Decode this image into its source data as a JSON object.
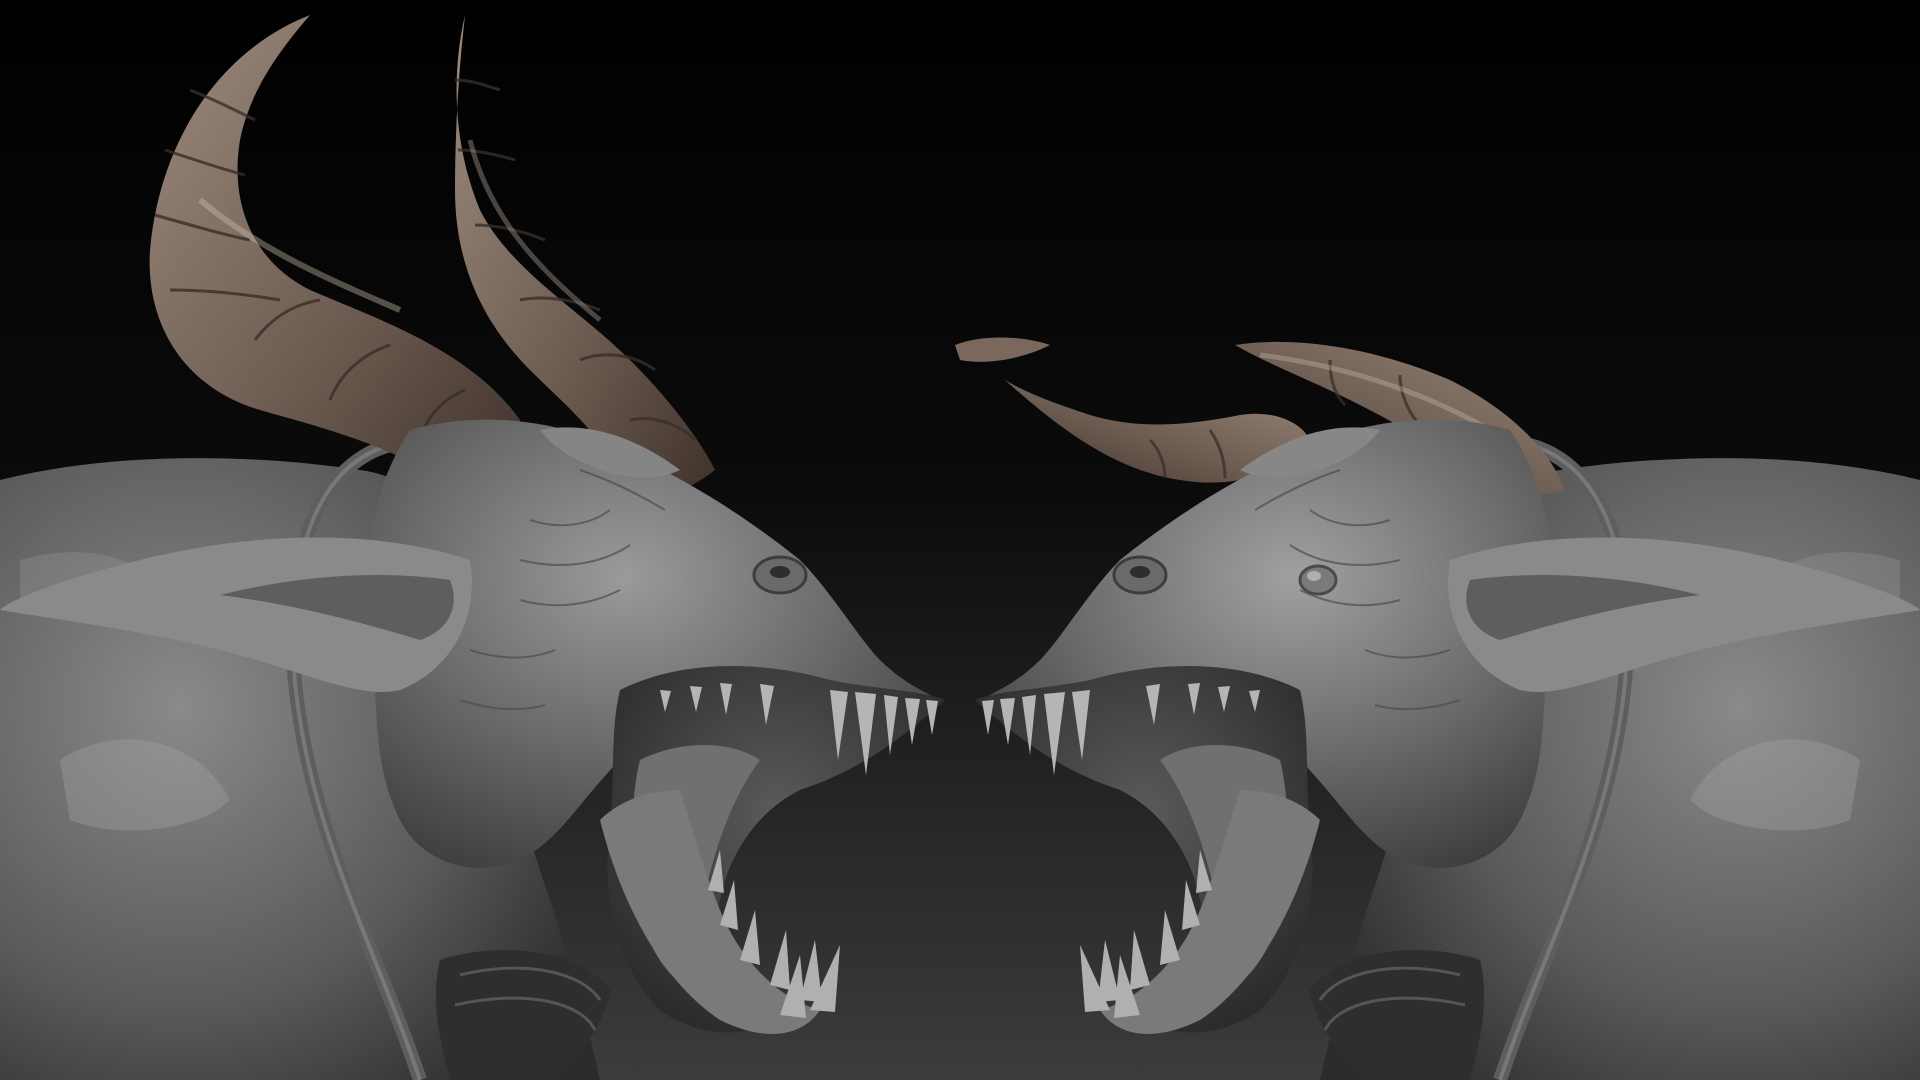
{
  "scene": {
    "subject": "two-demon-head-sculpts-facing",
    "colors": {
      "background_top": "#000000",
      "background_bottom": "#3c3c3c",
      "skin_light": "#9a9a9a",
      "skin_mid": "#6b6b6b",
      "skin_dark": "#3a3a3a",
      "horn_light": "#9c8a7d",
      "horn_mid": "#6f5e53",
      "horn_dark": "#3f322b",
      "teeth": "#b5b5b5",
      "mouth_interior": "#262626"
    }
  }
}
